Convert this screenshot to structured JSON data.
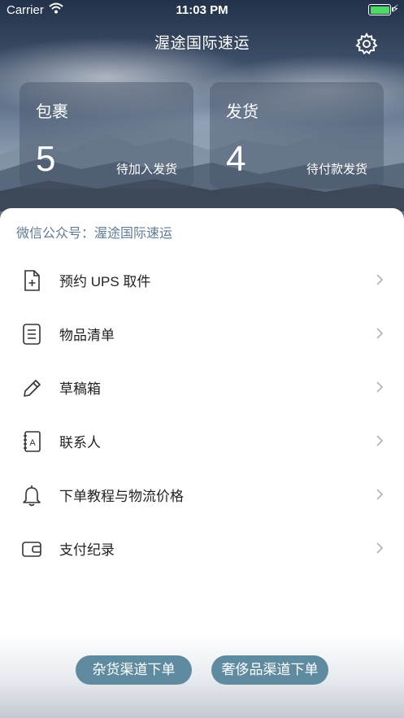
{
  "status_bar": {
    "carrier": "Carrier",
    "time": "11:03 PM",
    "battery_level": 1.0,
    "wifi_icon": "wifi-icon",
    "charging_icon": "bolt-icon"
  },
  "header": {
    "title": "渥途国际速运",
    "settings_icon": "gear-icon"
  },
  "cards": [
    {
      "label": "包裹",
      "count": "5",
      "sub": "待加入发货"
    },
    {
      "label": "发货",
      "count": "4",
      "sub": "待付款发货"
    }
  ],
  "wechat": {
    "text": "微信公众号：渥途国际速运"
  },
  "menu": [
    {
      "label": "预约 UPS 取件",
      "icon": "file-plus-icon"
    },
    {
      "label": "物品清单",
      "icon": "list-document-icon"
    },
    {
      "label": "草稿箱",
      "icon": "pencil-icon"
    },
    {
      "label": "联系人",
      "icon": "address-book-icon"
    },
    {
      "label": "下单教程与物流价格",
      "icon": "bell-icon"
    },
    {
      "label": "支付纪录",
      "icon": "wallet-icon"
    }
  ],
  "buttons": {
    "general_goods": "杂货渠道下单",
    "luxury_goods": "奢侈品渠道下单"
  },
  "colors": {
    "accent_button": "#5f8ba1",
    "wechat_text": "#5f7a95",
    "battery_fill": "#4cd964"
  }
}
